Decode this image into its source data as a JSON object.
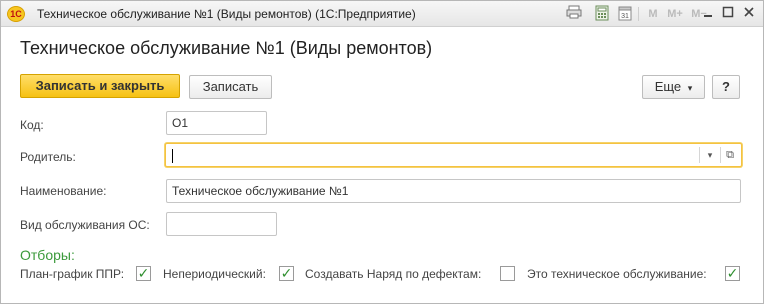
{
  "window": {
    "app_icon": "1С",
    "title": "Техническое обслуживание №1 (Виды ремонтов)  (1С:Предприятие)",
    "icons": {
      "print": "print-icon",
      "calculator": "calculator-icon",
      "calendar_day": "31",
      "m": "M",
      "m_plus": "M+",
      "m_minus": "M−",
      "minimize": "_",
      "maximize": "☐",
      "close": "✕"
    }
  },
  "header": {
    "title": "Техническое обслуживание №1 (Виды ремонтов)"
  },
  "toolbar": {
    "save_close_label": "Записать и закрыть",
    "save_label": "Записать",
    "more_label": "Еще",
    "more_arrow": "▾",
    "help_label": "?"
  },
  "form": {
    "code": {
      "label": "Код:",
      "value": "О1"
    },
    "parent": {
      "label": "Родитель:",
      "value": "",
      "dropdown_arrow": "▾",
      "open_icon": "⧉"
    },
    "name": {
      "label": "Наименование:",
      "value": "Техническое обслуживание №1"
    },
    "os_type": {
      "label": "Вид обслуживания ОС:",
      "value": ""
    }
  },
  "filters": {
    "title": "Отборы:",
    "items": [
      {
        "label": "План-график ППР:",
        "checked": true,
        "mark": "✓"
      },
      {
        "label": "Непериодический:",
        "checked": true,
        "mark": "✓"
      },
      {
        "label": "Создавать Наряд по дефектам:",
        "checked": false,
        "mark": ""
      },
      {
        "label": "Это техническое обслуживание:",
        "checked": true,
        "mark": "✓"
      }
    ]
  },
  "colors": {
    "accent_yellow": "#f6c113",
    "group_title_green": "#3b9a3b",
    "checkmark_green": "#2f8f2f"
  }
}
